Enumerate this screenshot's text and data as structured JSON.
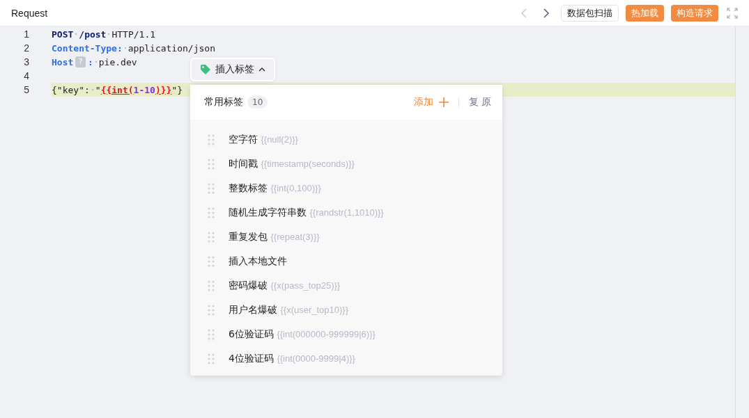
{
  "header": {
    "title": "Request",
    "nav": [
      {
        "kind": "back",
        "disabled": true
      },
      {
        "kind": "forward",
        "disabled": false
      }
    ],
    "buttons": [
      {
        "label": "数据包扫描",
        "kind": "outline"
      },
      {
        "label": "热加载",
        "kind": "primary"
      },
      {
        "label": "构造请求",
        "kind": "primary"
      }
    ]
  },
  "editor": {
    "lines": [
      {
        "number": "1",
        "highlighted": false,
        "tokens": [
          {
            "kind": "keyword",
            "text": "POST"
          },
          {
            "kind": "space"
          },
          {
            "kind": "keyword",
            "text": "/post"
          },
          {
            "kind": "space"
          },
          {
            "kind": "text",
            "text": "HTTP/1.1"
          }
        ]
      },
      {
        "number": "2",
        "highlighted": false,
        "tokens": [
          {
            "kind": "header",
            "text": "Content-Type:"
          },
          {
            "kind": "space"
          },
          {
            "kind": "text",
            "text": "application/json"
          }
        ]
      },
      {
        "number": "3",
        "highlighted": false,
        "tokens": [
          {
            "kind": "header",
            "text": "Host"
          },
          {
            "kind": "badge",
            "text": "?"
          },
          {
            "kind": "header",
            "text": ":"
          },
          {
            "kind": "space"
          },
          {
            "kind": "text",
            "text": "pie.dev"
          }
        ]
      },
      {
        "number": "4",
        "highlighted": false
      },
      {
        "number": "5",
        "highlighted": true,
        "tokens": [
          {
            "kind": "text",
            "text": "{\"key\":"
          },
          {
            "kind": "space"
          },
          {
            "kind": "text",
            "text": "\""
          },
          {
            "kind": "tag",
            "text": "{{int("
          },
          {
            "kind": "number",
            "text": "1-10"
          },
          {
            "kind": "tag",
            "text": ")}}"
          },
          {
            "kind": "text",
            "text": "\"}"
          }
        ]
      }
    ]
  },
  "tag_menu": {
    "button": {
      "label": "插入标签",
      "expanded": true
    },
    "title": "常用标签",
    "count": "10",
    "add": "添加",
    "reset": "复 原",
    "items": [
      {
        "name": "空字符",
        "code": "{{null(2)}}"
      },
      {
        "name": "时间戳",
        "code": "{{timestamp(seconds)}}"
      },
      {
        "name": "整数标签",
        "code": "{{int(0,100)}}"
      },
      {
        "name": "随机生成字符串数",
        "code": "{{randstr(1,1010)}}"
      },
      {
        "name": "重复发包",
        "code": "{{repeat(3)}}"
      },
      {
        "name": "插入本地文件"
      },
      {
        "name": "密码爆破",
        "code": "{{x(pass_top25)}}"
      },
      {
        "name": "用户名爆破",
        "code": "{{x(user_top10)}}"
      },
      {
        "name": "6位验证码",
        "code": "{{int(000000-999999|6)}}"
      },
      {
        "name": "4位验证码",
        "code": "{{int(0000-9999|4)}}"
      }
    ]
  }
}
